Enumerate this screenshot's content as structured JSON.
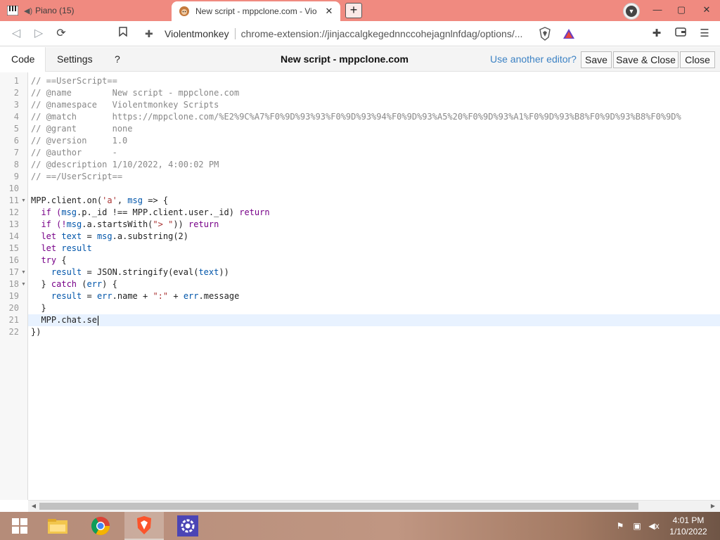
{
  "browser": {
    "tabs": [
      {
        "title": "Piano (15)",
        "active": false
      },
      {
        "title": "New script - mppclone.com - Vio",
        "active": true
      }
    ],
    "new_tab_label": "+",
    "window_controls": {
      "minimize": "—",
      "maximize": "▢",
      "close": "✕"
    },
    "address": {
      "site_label": "Violentmonkey",
      "url": "chrome-extension://jinjaccalgkegednnccohejagnlnfdag/options/..."
    }
  },
  "editor": {
    "tabs": [
      {
        "label": "Code",
        "active": true
      },
      {
        "label": "Settings",
        "active": false
      },
      {
        "label": "?",
        "active": false
      }
    ],
    "title": "New script - mppclone.com",
    "another_editor_link": "Use another editor?",
    "buttons": {
      "save": "Save",
      "save_close": "Save & Close",
      "close": "Close"
    },
    "line_numbers": [
      "1",
      "2",
      "3",
      "4",
      "5",
      "6",
      "7",
      "8",
      "9",
      "10",
      "11",
      "12",
      "13",
      "14",
      "15",
      "16",
      "17",
      "18",
      "19",
      "20",
      "21",
      "22"
    ],
    "foldable_lines": [
      11,
      17,
      18
    ],
    "active_line": 21,
    "code": {
      "l1": "// ==UserScript==",
      "l2": "// @name        New script - mppclone.com",
      "l3": "// @namespace   Violentmonkey Scripts",
      "l4": "// @match       https://mppclone.com/%E2%9C%A7%F0%9D%93%93%F0%9D%93%94%F0%9D%93%A5%20%F0%9D%93%A1%F0%9D%93%B8%F0%9D%93%B8%F0%9D%",
      "l5": "// @grant       none",
      "l6": "// @version     1.0",
      "l7": "// @author      -",
      "l8": "// @description 1/10/2022, 4:00:02 PM",
      "l9": "// ==/UserScript==",
      "l11a": "MPP.client.on(",
      "l11b": "'a'",
      "l11c": ", ",
      "l11d": "msg",
      "l11e": " => {",
      "l12a": "  if (",
      "l12b": "msg",
      "l12c": ".p._id !== MPP.client.user._id) ",
      "l12d": "return",
      "l13a": "  if (!",
      "l13b": "msg",
      "l13c": ".a.startsWith(",
      "l13d": "\"> \"",
      "l13e": ")) ",
      "l13f": "return",
      "l14a": "  let ",
      "l14b": "text",
      "l14c": " = ",
      "l14d": "msg",
      "l14e": ".a.substring(2)",
      "l15a": "  let ",
      "l15b": "result",
      "l16a": "  try",
      "l16b": " {",
      "l17a": "    ",
      "l17b": "result",
      "l17c": " = JSON.stringify(eval(",
      "l17d": "text",
      "l17e": "))",
      "l18a": "  } ",
      "l18b": "catch",
      "l18c": " (",
      "l18d": "err",
      "l18e": ") {",
      "l19a": "    ",
      "l19b": "result",
      "l19c": " = ",
      "l19d": "err",
      "l19e": ".name + ",
      "l19f": "\":\"",
      "l19g": " + ",
      "l19h": "err",
      "l19i": ".message",
      "l20": "  }",
      "l21": "  MPP.chat.se",
      "l22": "})"
    }
  },
  "taskbar": {
    "clock_time": "4:01 PM",
    "clock_date": "1/10/2022"
  },
  "colors": {
    "tabbar": "#f08a80",
    "link": "#3c82c4",
    "comment": "#888888",
    "string": "#aa3333",
    "keyword": "#770088",
    "variable": "#0055aa"
  }
}
